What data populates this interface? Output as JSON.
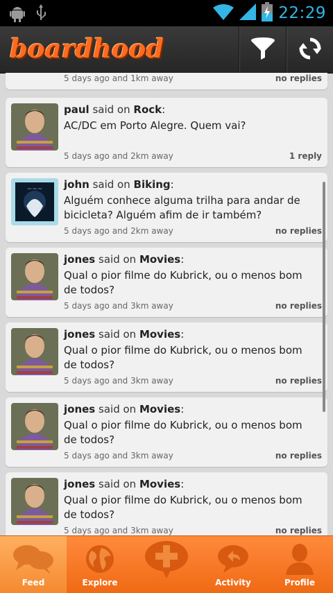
{
  "status_bar": {
    "time": "22:29"
  },
  "app": {
    "logo_text": "boardhood"
  },
  "toolbar": {
    "filter_icon": "filter-icon",
    "refresh_icon": "refresh-icon"
  },
  "posts": [
    {
      "user": "",
      "verb": "",
      "board": "",
      "message": "",
      "meta": "5 days ago and 1km away",
      "replies": "no replies"
    },
    {
      "user": "paul",
      "verb": "said on",
      "board": "Rock",
      "message": "AC/DC em Porto Alegre. Quem vai?",
      "meta": "5 days ago and 2km away",
      "replies": "1 reply"
    },
    {
      "user": "john",
      "verb": "said on",
      "board": "Biking",
      "message": "Alguém conhece alguma trilha para andar de bicicleta? Alguém afim de ir também?",
      "meta": "5 days ago and 2km away",
      "replies": "no replies"
    },
    {
      "user": "jones",
      "verb": "said on",
      "board": "Movies",
      "message": "Qual o pior filme do Kubrick, ou o menos bom de todos?",
      "meta": "5 days ago and 3km away",
      "replies": "no replies"
    },
    {
      "user": "jones",
      "verb": "said on",
      "board": "Movies",
      "message": "Qual o pior filme do Kubrick, ou o menos bom de todos?",
      "meta": "5 days ago and 3km away",
      "replies": "no replies"
    },
    {
      "user": "jones",
      "verb": "said on",
      "board": "Movies",
      "message": "Qual o pior filme do Kubrick, ou o menos bom de todos?",
      "meta": "5 days ago and 3km away",
      "replies": "no replies"
    },
    {
      "user": "jones",
      "verb": "said on",
      "board": "Movies",
      "message": "Qual o pior filme do Kubrick, ou o menos bom de todos?",
      "meta": "5 days ago and 3km away",
      "replies": "no replies"
    }
  ],
  "nav": [
    {
      "label": "Feed",
      "icon": "speech-bubbles-icon",
      "active": true
    },
    {
      "label": "Explore",
      "icon": "globe-icon",
      "active": false
    },
    {
      "label": "",
      "icon": "add-post-icon",
      "active": false
    },
    {
      "label": "Activity",
      "icon": "reply-bubble-icon",
      "active": false
    },
    {
      "label": "Profile",
      "icon": "person-icon",
      "active": false
    }
  ],
  "colors": {
    "accent": "#f06a14",
    "status_time": "#33b5e5",
    "logo": "#ff6a1f"
  }
}
